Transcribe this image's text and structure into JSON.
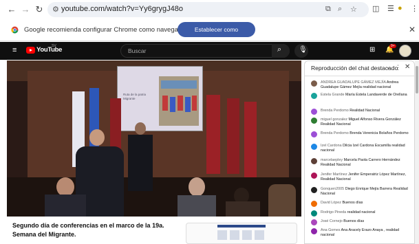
{
  "browser": {
    "url": "youtube.com/watch?v=Yy6grygJ48o",
    "infobar_text": "Google recomienda configurar Chrome como navegador predeterminado",
    "infobar_button": "Establecer como predeterminado"
  },
  "youtube": {
    "logo": "YouTube",
    "logo_region": "SV",
    "search_placeholder": "Buscar",
    "notification_count": "9+"
  },
  "video": {
    "slide_text": "Ruta de la patria Migrante"
  },
  "chat": {
    "header": "Reproducción del chat destacado",
    "messages": [
      {
        "author": "ANDREA GUADALUPE GÁMEZ MEJÍA",
        "text": "Andrea Guadalupe Gámez Mejía realidad nacional",
        "color": "#7a5c4a"
      },
      {
        "author": "Estela Grande",
        "text": "María Estela Landaverde de Orellana",
        "color": "#1aa39b"
      },
      {
        "author": "Brenda Perdomo",
        "text": "Realidad Nacional",
        "color": "#9c4fd6"
      },
      {
        "author": "miguel gonzalez",
        "text": "Miguel Alfonso Rivera González Realidad Nacional",
        "color": "#2e7d32"
      },
      {
        "author": "Brenda Perdomo",
        "text": "Brenda Verenicia Bolaños Perdomo",
        "color": "#9c4fd6"
      },
      {
        "author": "Izel Cardona",
        "text": "Dilcia Izel Cardona Escamilla realidad nacional",
        "color": "#1e88e5"
      },
      {
        "author": "marcelaepley",
        "text": "Marcela Paola Carrero Hernández Realidad Nacional",
        "color": "#5d4037"
      },
      {
        "author": "Jenifer Martínez",
        "text": "Jenifer Emperatriz López Martínez, Realidad Nacional",
        "color": "#ad1457"
      },
      {
        "author": "Gonquen2005",
        "text": "Diego Enrique Mejía Barrera Realidad Nacional",
        "color": "#212121"
      },
      {
        "author": "David López",
        "text": "Buenos días",
        "color": "#ef6c00"
      },
      {
        "author": "Rodrigo Pineda",
        "text": "realidad nacional",
        "color": "#00897b"
      },
      {
        "author": "José Cornejo",
        "text": "Buenos días",
        "color": "#ab47bc"
      },
      {
        "author": "Ana Gomes",
        "text": "Ana Aracely Erazo Anaya , realidad nacional",
        "color": "#8e24aa"
      }
    ]
  },
  "main": {
    "title": "Segundo día de conferencias en el marco de la 19a. Semana del Migrante."
  }
}
